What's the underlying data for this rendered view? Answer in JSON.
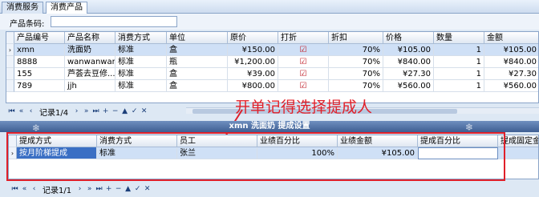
{
  "tabs": [
    "消费服务",
    "消费产品"
  ],
  "search": {
    "label": "产品条码:",
    "value": ""
  },
  "grid": {
    "columns": [
      "产品编号",
      "产品名称",
      "消费方式",
      "单位",
      "原价",
      "打折",
      "折扣",
      "价格",
      "数量",
      "金额"
    ],
    "rows": [
      [
        "xmn",
        "洗面奶",
        "标准",
        "盒",
        "¥150.00",
        "",
        "70%",
        "¥105.00",
        "1",
        "¥105.00"
      ],
      [
        "8888",
        "wanwanwan",
        "标准",
        "瓶",
        "¥1,200.00",
        "",
        "70%",
        "¥840.00",
        "1",
        "¥840.00"
      ],
      [
        "155",
        "芦荟去豆修...",
        "标准",
        "盒",
        "¥39.00",
        "",
        "70%",
        "¥27.30",
        "1",
        "¥27.30"
      ],
      [
        "789",
        "jjh",
        "标准",
        "盒",
        "¥800.00",
        "",
        "70%",
        "¥560.00",
        "1",
        "¥560.00"
      ]
    ],
    "record": "记录1/4"
  },
  "annotation": "开单记得选择提成人",
  "detail": {
    "title": "xmn 洗面奶 提成设置",
    "columns": [
      "提成方式",
      "消费方式",
      "员工",
      "业绩百分比",
      "业绩金额",
      "提成百分比",
      "提成固定金额"
    ],
    "rows": [
      [
        "按月阶梯提成",
        "标准",
        "张兰",
        "100%",
        "¥105.00",
        "",
        ""
      ]
    ],
    "record": "记录1/1"
  }
}
